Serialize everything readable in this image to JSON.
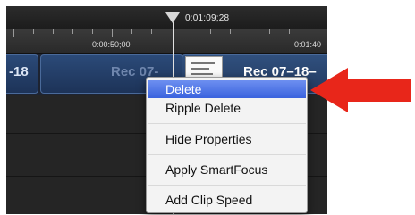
{
  "timeline": {
    "playhead_time": "0:01:09;28",
    "ruler_labels": [
      "0:00:50;00",
      "0:01:40"
    ],
    "clips": [
      {
        "label": "-18"
      },
      {
        "label": "Rec 07-"
      },
      {
        "label": "Rec 07–18–"
      }
    ]
  },
  "context_menu": {
    "items": [
      {
        "label": "Delete",
        "selected": true
      },
      {
        "label": "Ripple Delete"
      },
      {
        "label": "Hide Properties"
      },
      {
        "label": "Apply SmartFocus"
      },
      {
        "label": "Add Clip Speed"
      }
    ]
  },
  "colors": {
    "selection": "#3a63de",
    "annotation_arrow": "#e8261a",
    "clip": "#2b4a78"
  },
  "icons": {
    "playhead": "playhead-triangle-icon",
    "arrow": "red-pointer-arrow-icon"
  }
}
